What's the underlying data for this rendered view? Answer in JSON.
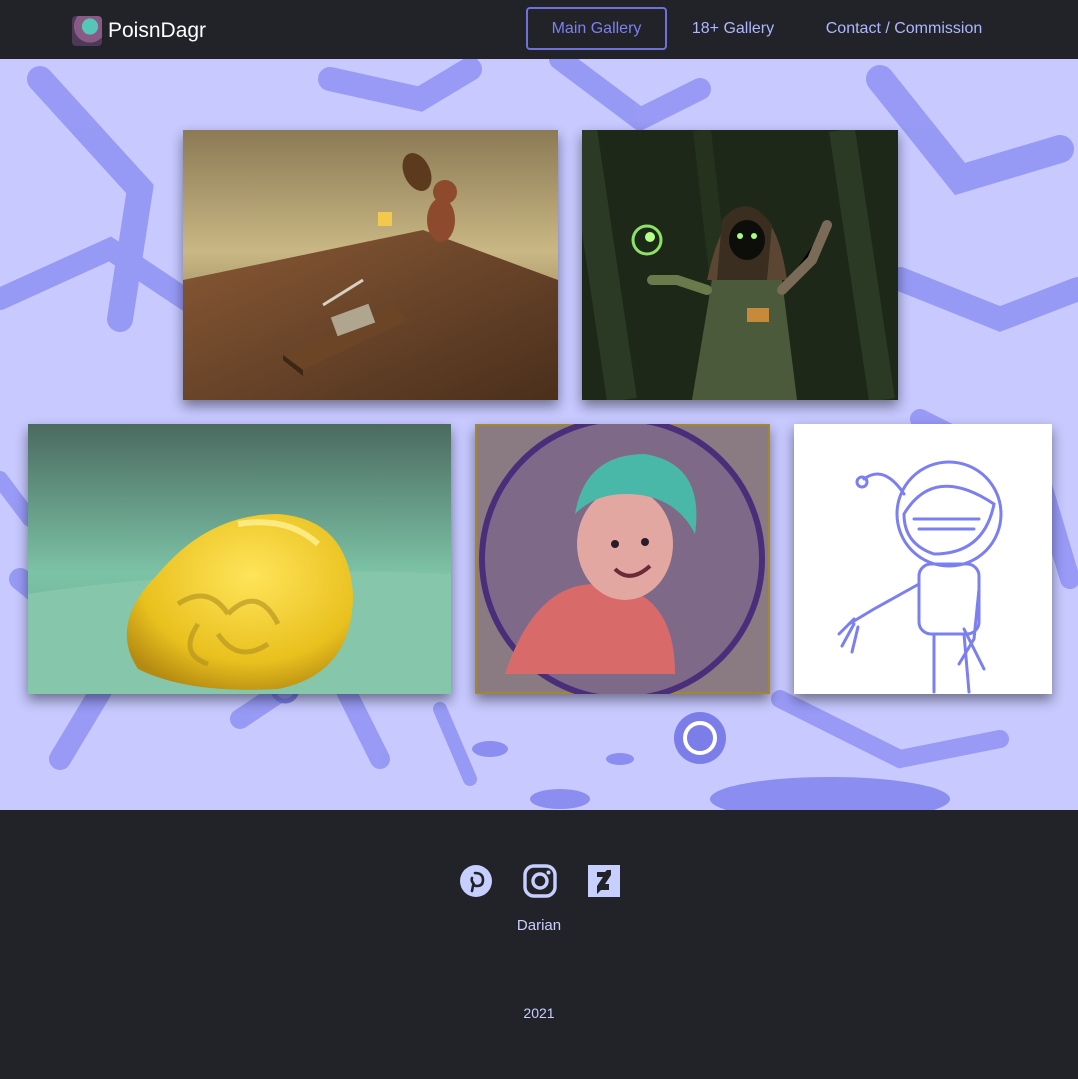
{
  "brand": {
    "name": "PoisnDagr",
    "logo_icon": "avatar-logo-icon"
  },
  "nav": {
    "items": [
      {
        "label": "Main Gallery",
        "active": true
      },
      {
        "label": "18+ Gallery",
        "active": false
      },
      {
        "label": "Contact / Commission",
        "active": false
      }
    ]
  },
  "gallery": {
    "images": [
      {
        "name": "mouse-trap-artwork"
      },
      {
        "name": "hooded-druid-artwork"
      },
      {
        "name": "yellow-blob-artwork"
      },
      {
        "name": "bubble-boy-portrait-artwork"
      },
      {
        "name": "anglerfish-astronaut-sketch-artwork"
      }
    ]
  },
  "footer": {
    "social": [
      {
        "icon": "pinterest-icon"
      },
      {
        "icon": "instagram-icon"
      },
      {
        "icon": "deviantart-icon"
      }
    ],
    "name": "Darian",
    "year": "2021"
  },
  "colors": {
    "dark": "#212328",
    "accent": "#7c80f0",
    "nav_text": "#aeb7ff",
    "gallery_bg": "#c7c9ff",
    "icon_color": "#c7cfff"
  }
}
